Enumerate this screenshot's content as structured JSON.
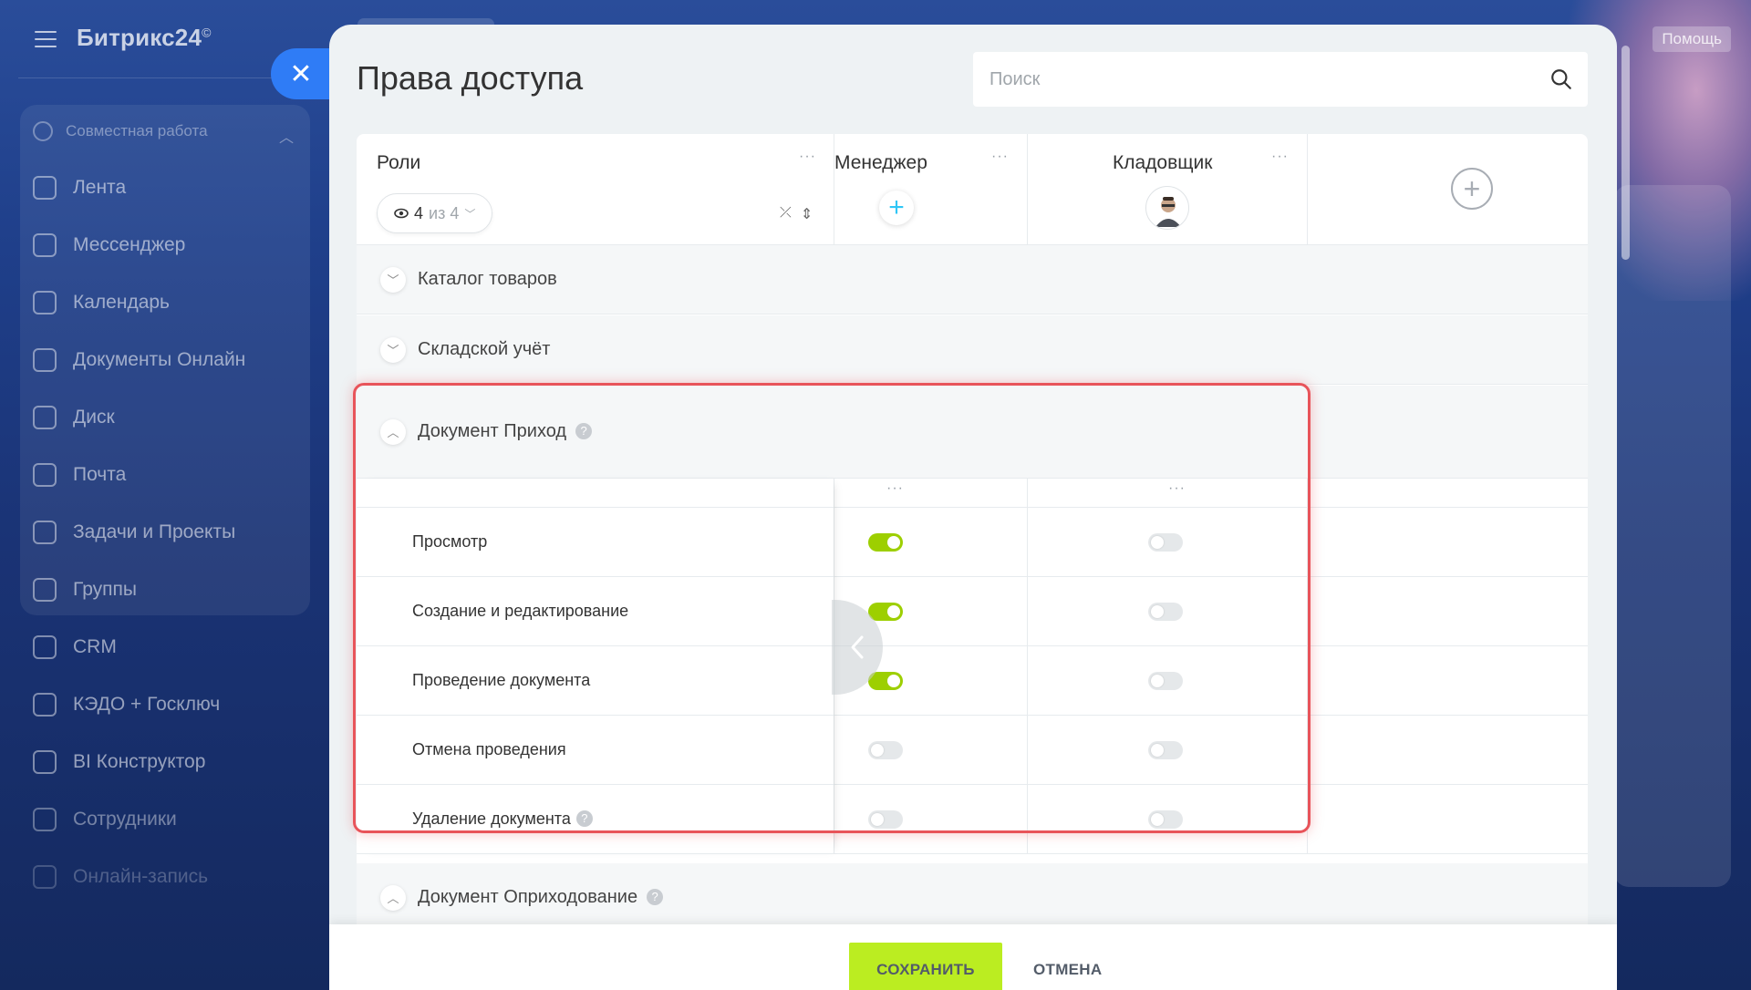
{
  "app": {
    "logo": "Битрикс24",
    "logo_mark": "©",
    "help_label": "Помощь"
  },
  "sidebar": {
    "section_label": "Совместная работа",
    "items": [
      {
        "label": "Лента",
        "icon": "feed-icon"
      },
      {
        "label": "Мессенджер",
        "icon": "messenger-icon"
      },
      {
        "label": "Календарь",
        "icon": "calendar-icon"
      },
      {
        "label": "Документы Онлайн",
        "icon": "document-icon"
      },
      {
        "label": "Диск",
        "icon": "disk-icon"
      },
      {
        "label": "Почта",
        "icon": "mail-icon"
      },
      {
        "label": "Задачи и Проекты",
        "icon": "tasks-icon"
      },
      {
        "label": "Группы",
        "icon": "groups-icon"
      },
      {
        "label": "CRM",
        "icon": "crm-icon"
      },
      {
        "label": "КЭДО + Госключ",
        "icon": "kedo-icon"
      },
      {
        "label": "BI Конструктор",
        "icon": "bi-icon"
      },
      {
        "label": "Сотрудники",
        "icon": "employees-icon"
      },
      {
        "label": "Онлайн-запись",
        "icon": "booking-icon"
      }
    ]
  },
  "panel": {
    "title": "Права доступа",
    "search_placeholder": "Поиск",
    "roles_label": "Роли",
    "counter": {
      "shown": "4",
      "of_text": "из 4"
    },
    "roles": [
      {
        "name": "Менеджер"
      },
      {
        "name": "Кладовщик"
      }
    ],
    "sections": [
      {
        "title": "Каталог товаров",
        "expanded": false
      },
      {
        "title": "Складской учёт",
        "expanded": false
      },
      {
        "title": "Документ Приход",
        "expanded": true,
        "permissions": [
          {
            "label": "Просмотр",
            "values": [
              true,
              false
            ]
          },
          {
            "label": "Создание и редактирование",
            "values": [
              true,
              false
            ]
          },
          {
            "label": "Проведение документа",
            "values": [
              true,
              false
            ]
          },
          {
            "label": "Отмена проведения",
            "values": [
              false,
              false
            ]
          },
          {
            "label": "Удаление документа",
            "values": [
              false,
              false
            ],
            "help": true
          }
        ]
      },
      {
        "title": "Документ Оприходование",
        "expanded": true
      }
    ]
  },
  "footer": {
    "save_label": "СОХРАНИТЬ",
    "cancel_label": "ОТМЕНА"
  },
  "colors": {
    "accent": "#2f7cf6",
    "toggle_on": "#9dcf00",
    "save_button": "#bbed21",
    "highlight": "#e8545a"
  }
}
